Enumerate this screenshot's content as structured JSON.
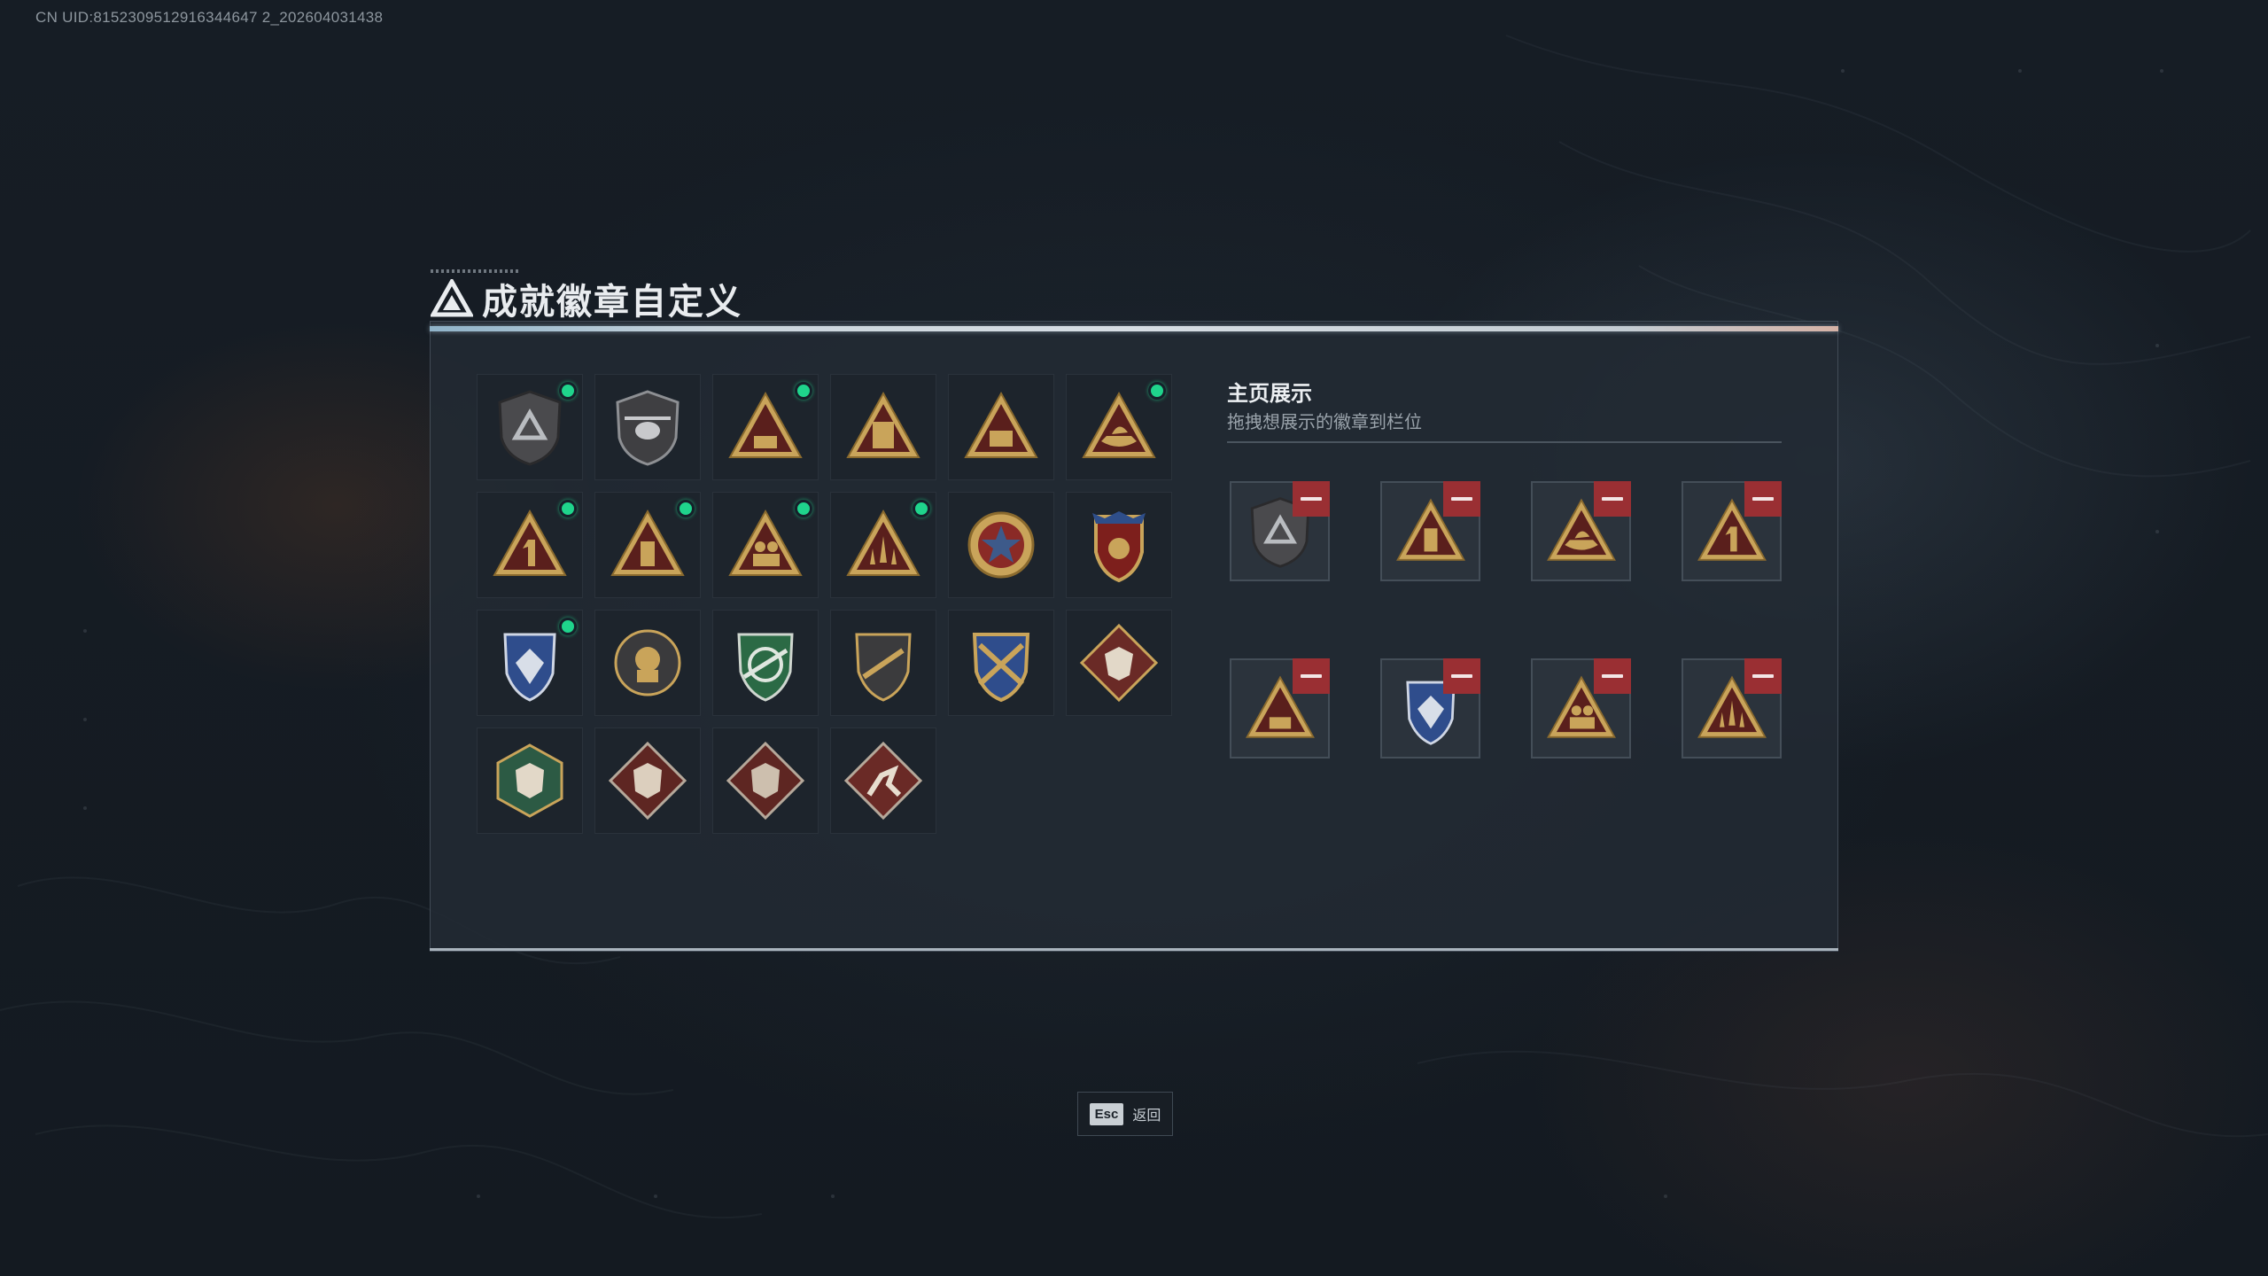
{
  "uid": "CN UID:8152309512916344647 2_202604031438",
  "title": "成就徽章自定义",
  "colors": {
    "accent_green": "#1fd48c",
    "remove_red": "#9a2f33",
    "panel_bg": "#222a33"
  },
  "badges": [
    {
      "name": "shield-delta-badge-icon",
      "selected": true
    },
    {
      "name": "helicopter-badge-icon",
      "selected": false
    },
    {
      "name": "triangle-s6-badge-icon",
      "selected": true
    },
    {
      "name": "triangle-s7-badge-icon",
      "selected": false
    },
    {
      "name": "triangle-s8-badge-icon",
      "selected": false
    },
    {
      "name": "triangle-boat-badge-icon",
      "selected": true
    },
    {
      "name": "triangle-number-1-badge-icon",
      "selected": true
    },
    {
      "name": "triangle-tower-badge-icon",
      "selected": true
    },
    {
      "name": "triangle-soldiers-badge-icon",
      "selected": true
    },
    {
      "name": "triangle-rockets-badge-icon",
      "selected": true
    },
    {
      "name": "star-medal-badge-icon",
      "selected": false
    },
    {
      "name": "eagle-shield-badge-icon",
      "selected": false
    },
    {
      "name": "blue-crest-badge-icon",
      "selected": true
    },
    {
      "name": "skull-portrait-badge-icon",
      "selected": false
    },
    {
      "name": "green-rifle-shield-badge-icon",
      "selected": false
    },
    {
      "name": "rifle-shield-badge-icon",
      "selected": false
    },
    {
      "name": "crossed-rifles-badge-icon",
      "selected": false
    },
    {
      "name": "wolf-diamond-badge-icon",
      "selected": false
    },
    {
      "name": "dragon-hexagon-badge-icon",
      "selected": false
    },
    {
      "name": "dragon-diamond-badge-icon",
      "selected": false
    },
    {
      "name": "dragon-diamond-2-badge-icon",
      "selected": false
    },
    {
      "name": "runner-diamond-badge-icon",
      "selected": false
    }
  ],
  "showcase": {
    "title": "主页展示",
    "subtitle": "拖拽想展示的徽章到栏位",
    "slots": [
      "shield-delta-badge-icon",
      "triangle-tower-badge-icon",
      "triangle-boat-badge-icon",
      "triangle-number-1-badge-icon",
      "triangle-s6-badge-icon",
      "blue-crest-badge-icon",
      "triangle-soldiers-badge-icon",
      "triangle-rockets-badge-icon"
    ]
  },
  "footer": {
    "key": "Esc",
    "label": "返回"
  }
}
